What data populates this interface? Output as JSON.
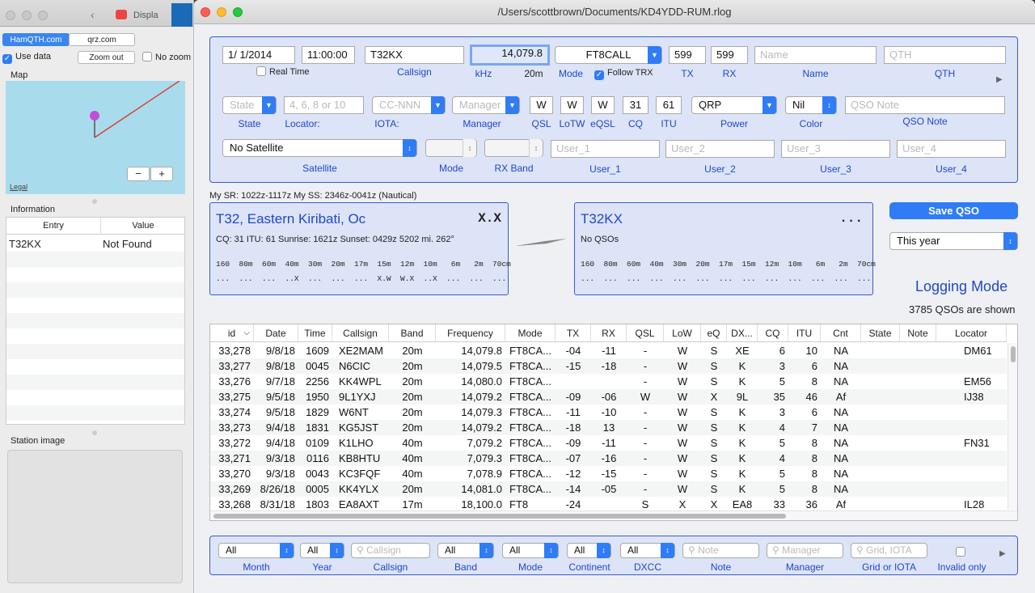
{
  "bg_window": {
    "tab_title": "Displa",
    "seg_hamqth": "HamQTH.com",
    "seg_qrz": "qrz.com",
    "use_data": "Use data",
    "zoom_out": "Zoom out",
    "no_zoom": "No zoom",
    "map_label": "Map",
    "legal": "Legal",
    "minus": "−",
    "plus": "+",
    "info_label": "Information",
    "col_entry": "Entry",
    "col_value": "Value",
    "row_entry": "T32KX",
    "row_value": "Not Found",
    "station_image": "Station image"
  },
  "window": {
    "title": "/Users/scottbrown/Documents/KD4YDD-RUM.rlog"
  },
  "entry": {
    "date": "1/  1/2014",
    "time": "11:00:00",
    "real_time": "Real Time",
    "callsign": "T32KX",
    "callsign_label": "Callsign",
    "freq": "14,079.8",
    "khz_label": "kHz",
    "band_label": "20m",
    "mode": "FT8CALL",
    "mode_label": "Mode",
    "follow_trx": "Follow TRX",
    "tx": "599",
    "tx_label": "TX",
    "rx": "599",
    "rx_label": "RX",
    "name_ph": "Name",
    "name_label": "Name",
    "qth_ph": "QTH",
    "qth_label": "QTH",
    "state_ph": "State",
    "state_label": "State",
    "locator_ph": "4, 6, 8 or 10",
    "locator_label": "Locator:",
    "iota_ph": "CC-NNN",
    "iota_label": "IOTA:",
    "manager_ph": "Manager",
    "manager_label": "Manager",
    "qsl": "W",
    "qsl_label": "QSL",
    "lotw": "W",
    "lotw_label": "LoTW",
    "eqsl": "W",
    "eqsl_label": "eQSL",
    "cq": "31",
    "cq_label": "CQ",
    "itu": "61",
    "itu_label": "ITU",
    "power": "QRP",
    "power_label": "Power",
    "color": "Nil",
    "color_label": "Color",
    "qso_note_ph": "QSO Note",
    "qso_note_label": "QSO Note",
    "satellite": "No Satellite",
    "satellite_label": "Satellite",
    "sat_mode_label": "Mode",
    "rx_band_label": "RX Band",
    "user1_ph": "User_1",
    "user1_label": "User_1",
    "user2_ph": "User_2",
    "user2_label": "User_2",
    "user3_ph": "User_3",
    "user3_label": "User_3",
    "user4_ph": "User_4",
    "user4_label": "User_4"
  },
  "sr_ss": "My SR: 1022z-1117z  My SS: 2346z-0041z (Nautical)",
  "dx_card": {
    "title": "T32, Eastern Kiribati, Oc",
    "flag": "X.X",
    "info": "CQ: 31  ITU: 61  Sunrise: 1621z  Sunset: 0429z  5202 mi.  262°",
    "bands": "160  80m  60m  40m  30m  20m  17m  15m  12m  10m   6m   2m  70cm",
    "marks": "...  ...  ...  ..X  ...  ...  ...  X.W  W.X  ..X  ...  ...  ..."
  },
  "call_card": {
    "title": "T32KX",
    "flag": "...",
    "info": "No QSOs",
    "bands": "160  80m  60m  40m  30m  20m  17m  15m  12m  10m   6m   2m  70cm",
    "marks": "...  ...  ...  ...  ...  ...  ...  ...  ...  ...  ...  ...  ..."
  },
  "save_qso": "Save QSO",
  "period": "This year",
  "logging_mode": "Logging Mode",
  "qso_count": "3785 QSOs are shown",
  "table": {
    "headers": [
      "id",
      "Date",
      "Time",
      "Callsign",
      "Band",
      "Frequency",
      "Mode",
      "TX",
      "RX",
      "QSL",
      "LoW",
      "eQ",
      "DX...",
      "CQ",
      "ITU",
      "Cnt",
      "State",
      "Note",
      "Locator"
    ],
    "rows": [
      [
        "33,278",
        "9/8/18",
        "1609",
        "XE2MAM",
        "20m",
        "14,079.8",
        "FT8CA...",
        "-04",
        "-11",
        "-",
        "W",
        "S",
        "XE",
        "6",
        "10",
        "NA",
        "",
        "",
        "DM61"
      ],
      [
        "33,277",
        "9/8/18",
        "0045",
        "N6CIC",
        "20m",
        "14,079.5",
        "FT8CA...",
        "-15",
        "-18",
        "-",
        "W",
        "S",
        "K",
        "3",
        "6",
        "NA",
        "",
        "",
        ""
      ],
      [
        "33,276",
        "9/7/18",
        "2256",
        "KK4WPL",
        "20m",
        "14,080.0",
        "FT8CA...",
        "",
        "",
        "-",
        "W",
        "S",
        "K",
        "5",
        "8",
        "NA",
        "",
        "",
        "EM56"
      ],
      [
        "33,275",
        "9/5/18",
        "1950",
        "9L1YXJ",
        "20m",
        "14,079.2",
        "FT8CA...",
        "-09",
        "-06",
        "W",
        "W",
        "X",
        "9L",
        "35",
        "46",
        "Af",
        "",
        "",
        "IJ38"
      ],
      [
        "33,274",
        "9/5/18",
        "1829",
        "W6NT",
        "20m",
        "14,079.3",
        "FT8CA...",
        "-11",
        "-10",
        "-",
        "W",
        "S",
        "K",
        "3",
        "6",
        "NA",
        "",
        "",
        ""
      ],
      [
        "33,273",
        "9/4/18",
        "1831",
        "KG5JST",
        "20m",
        "14,079.2",
        "FT8CA...",
        "-18",
        "13",
        "-",
        "W",
        "S",
        "K",
        "4",
        "7",
        "NA",
        "",
        "",
        ""
      ],
      [
        "33,272",
        "9/4/18",
        "0109",
        "K1LHO",
        "40m",
        "7,079.2",
        "FT8CA...",
        "-09",
        "-11",
        "-",
        "W",
        "S",
        "K",
        "5",
        "8",
        "NA",
        "",
        "",
        "FN31"
      ],
      [
        "33,271",
        "9/3/18",
        "0116",
        "KB8HTU",
        "40m",
        "7,079.3",
        "FT8CA...",
        "-07",
        "-16",
        "-",
        "W",
        "S",
        "K",
        "4",
        "8",
        "NA",
        "",
        "",
        ""
      ],
      [
        "33,270",
        "9/3/18",
        "0043",
        "KC3FQF",
        "40m",
        "7,078.9",
        "FT8CA...",
        "-12",
        "-15",
        "-",
        "W",
        "S",
        "K",
        "5",
        "8",
        "NA",
        "",
        "",
        ""
      ],
      [
        "33,269",
        "8/26/18",
        "0005",
        "KK4YLX",
        "20m",
        "14,081.0",
        "FT8CA...",
        "-14",
        "-05",
        "-",
        "W",
        "S",
        "K",
        "5",
        "8",
        "NA",
        "",
        "",
        ""
      ],
      [
        "33,268",
        "8/31/18",
        "1803",
        "EA8AXT",
        "17m",
        "18,100.0",
        "FT8",
        "-24",
        "",
        "S",
        "X",
        "X",
        "EA8",
        "33",
        "36",
        "Af",
        "",
        "",
        "IL28"
      ]
    ]
  },
  "filters": {
    "month": "All",
    "month_label": "Month",
    "year": "All",
    "year_label": "Year",
    "callsign_ph": "Callsign",
    "callsign_label": "Callsign",
    "band": "All",
    "band_label": "Band",
    "mode": "All",
    "mode_label": "Mode",
    "continent": "All",
    "continent_label": "Continent",
    "dxcc": "All",
    "dxcc_label": "DXCC",
    "note_ph": "Note",
    "note_label": "Note",
    "manager_ph": "Manager",
    "manager_label": "Manager",
    "grid_ph": "Grid, IOTA",
    "grid_label": "Grid or IOTA",
    "invalid_label": "Invalid only"
  }
}
